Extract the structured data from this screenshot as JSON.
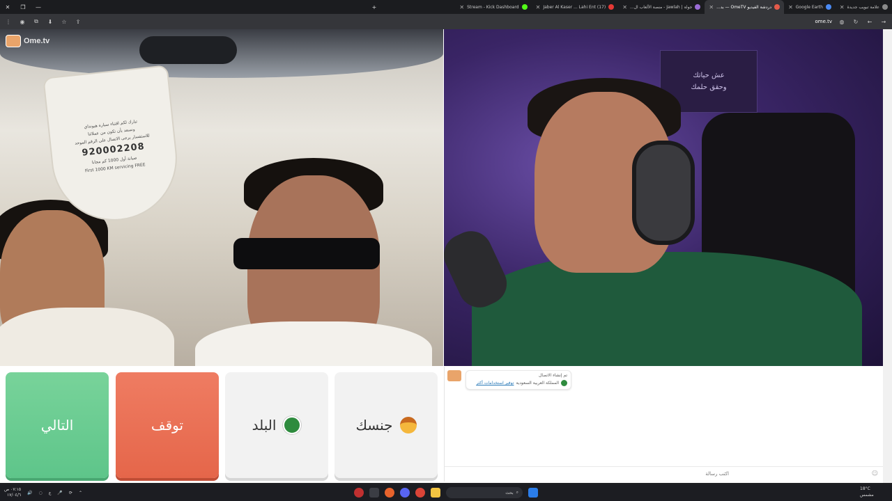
{
  "window": {
    "min": "—",
    "restore": "❐",
    "close": "✕",
    "new_tab": "+"
  },
  "tabs": [
    {
      "title": "علامة تبويب جديدة",
      "color": "#8a8a8a"
    },
    {
      "title": "Google Earth",
      "color": "#4a8af4"
    },
    {
      "title": "دردشة الفيديو OmeTV — بد...",
      "color": "#e45a4a",
      "active": true
    },
    {
      "title": "جولة | Jawlah - منصة الألعاب ال...",
      "color": "#9a6cd6"
    },
    {
      "title": "(17) Jaber Al Kaser ... Lahi Ent",
      "color": "#e53935"
    },
    {
      "title": "Stream - Kick Dashboard",
      "color": "#53fc18"
    }
  ],
  "toolbar": {
    "url": "ome.tv"
  },
  "brand": {
    "name": "Ome.tv"
  },
  "car_tag": {
    "lines": [
      "تبارك لكم اقتناء سيارة هيونداي",
      "ونسعد بأن تكون من عملائنا",
      "للاستفسار يرجى الاتصال على الرقم الموحد"
    ],
    "phone": "920002208",
    "offer": "صيانة أول 1000 كم مجانا",
    "offer_en": "First 1000 KM servicing FREE"
  },
  "neon_sign": [
    "عش حياتك",
    "وحقق حلمك"
  ],
  "buttons": {
    "next": "التالي",
    "stop": "توقف",
    "country": "البلد",
    "gender": "جنسك"
  },
  "chat": {
    "system_line1": "تم إنشاء الاتصال",
    "system_link": "توفير استخدامات أكثر",
    "system_country": "المملكة العربية السعودية",
    "input_placeholder": "اكتب رسالة",
    "emoji": "☺"
  },
  "taskbar": {
    "search_placeholder": "بحث",
    "time": "٠٧:١٥ ص",
    "date": "١٧/٠٤/٦",
    "lang": "ع",
    "temp": "18°C",
    "weather": "مشمس"
  }
}
